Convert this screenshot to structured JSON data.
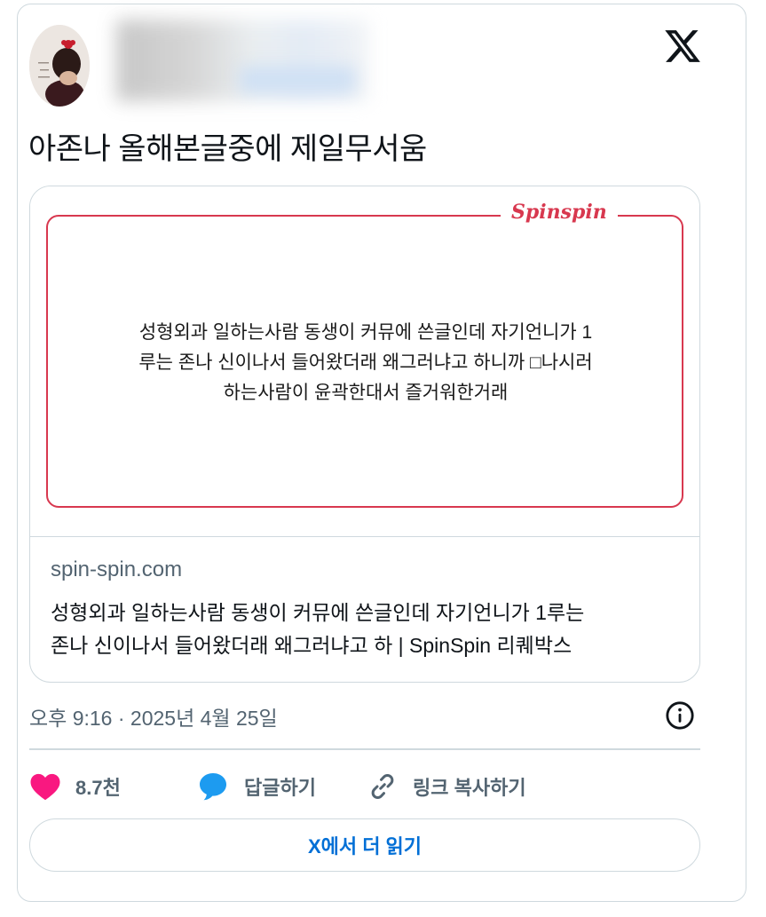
{
  "tweet": {
    "text": "아존나 올해본글중에 제일무서움",
    "timestamp": "오후 9:16 · 2025년 4월 25일"
  },
  "link_card": {
    "brand": "Spinspin",
    "preview_lines": [
      "성형외과 일하는사람 동생이 커뮤에 쓴글인데 자기언니가 1",
      "루는 존나 신이나서 들어왔더래 왜그러냐고 하니까 □나시러",
      "하는사람이 윤곽한대서 즐거워한거래"
    ],
    "domain": "spin-spin.com",
    "title_lines": [
      "성형외과 일하는사람 동생이 커뮤에 쓴글인데 자기언니가 1루는",
      "존나 신이나서 들어왔더래 왜그러냐고 하 | SpinSpin 리퀘박스"
    ]
  },
  "actions": {
    "like_count": "8.7천",
    "reply_label": "답글하기",
    "copy_link_label": "링크 복사하기"
  },
  "read_more_label": "X에서 더 읽기",
  "colors": {
    "like": "#f91880",
    "reply": "#1d9bf0",
    "brand": "#d8384f",
    "link": "#006fd6"
  },
  "icons": [
    "x-logo-icon",
    "info-icon",
    "heart-icon",
    "speech-bubble-icon",
    "link-icon"
  ]
}
